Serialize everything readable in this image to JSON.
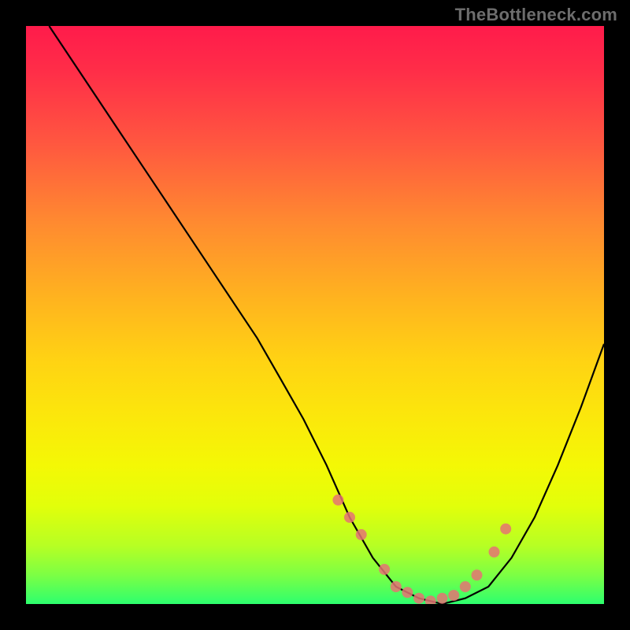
{
  "watermark": "TheBottleneck.com",
  "chart_data": {
    "type": "line",
    "title": "",
    "xlabel": "",
    "ylabel": "",
    "xlim": [
      0,
      100
    ],
    "ylim": [
      0,
      100
    ],
    "grid": false,
    "legend": false,
    "series": [
      {
        "name": "curve",
        "x": [
          4,
          8,
          12,
          16,
          20,
          24,
          28,
          32,
          36,
          40,
          44,
          48,
          52,
          56,
          60,
          64,
          68,
          72,
          76,
          80,
          84,
          88,
          92,
          96,
          100
        ],
        "y": [
          100,
          94,
          88,
          82,
          76,
          70,
          64,
          58,
          52,
          46,
          39,
          32,
          24,
          15,
          8,
          3,
          1,
          0,
          1,
          3,
          8,
          15,
          24,
          34,
          45
        ]
      }
    ],
    "markers": {
      "name": "highlight-points",
      "x": [
        54,
        56,
        58,
        62,
        64,
        66,
        68,
        70,
        72,
        74,
        76,
        78,
        81,
        83
      ],
      "y": [
        18,
        15,
        12,
        6,
        3,
        2,
        1,
        0.5,
        1,
        1.5,
        3,
        5,
        9,
        13
      ]
    },
    "gradient_stops": [
      {
        "pct": 0,
        "color": "#ff1b4b"
      },
      {
        "pct": 8,
        "color": "#ff2e48"
      },
      {
        "pct": 20,
        "color": "#ff5640"
      },
      {
        "pct": 34,
        "color": "#ff8a30"
      },
      {
        "pct": 47,
        "color": "#ffb31f"
      },
      {
        "pct": 58,
        "color": "#ffd313"
      },
      {
        "pct": 68,
        "color": "#fbe80b"
      },
      {
        "pct": 76,
        "color": "#f4f805"
      },
      {
        "pct": 83,
        "color": "#e2ff0a"
      },
      {
        "pct": 90,
        "color": "#b6ff24"
      },
      {
        "pct": 95,
        "color": "#7cff44"
      },
      {
        "pct": 100,
        "color": "#2dff6e"
      }
    ],
    "marker_color": "#e57373"
  }
}
